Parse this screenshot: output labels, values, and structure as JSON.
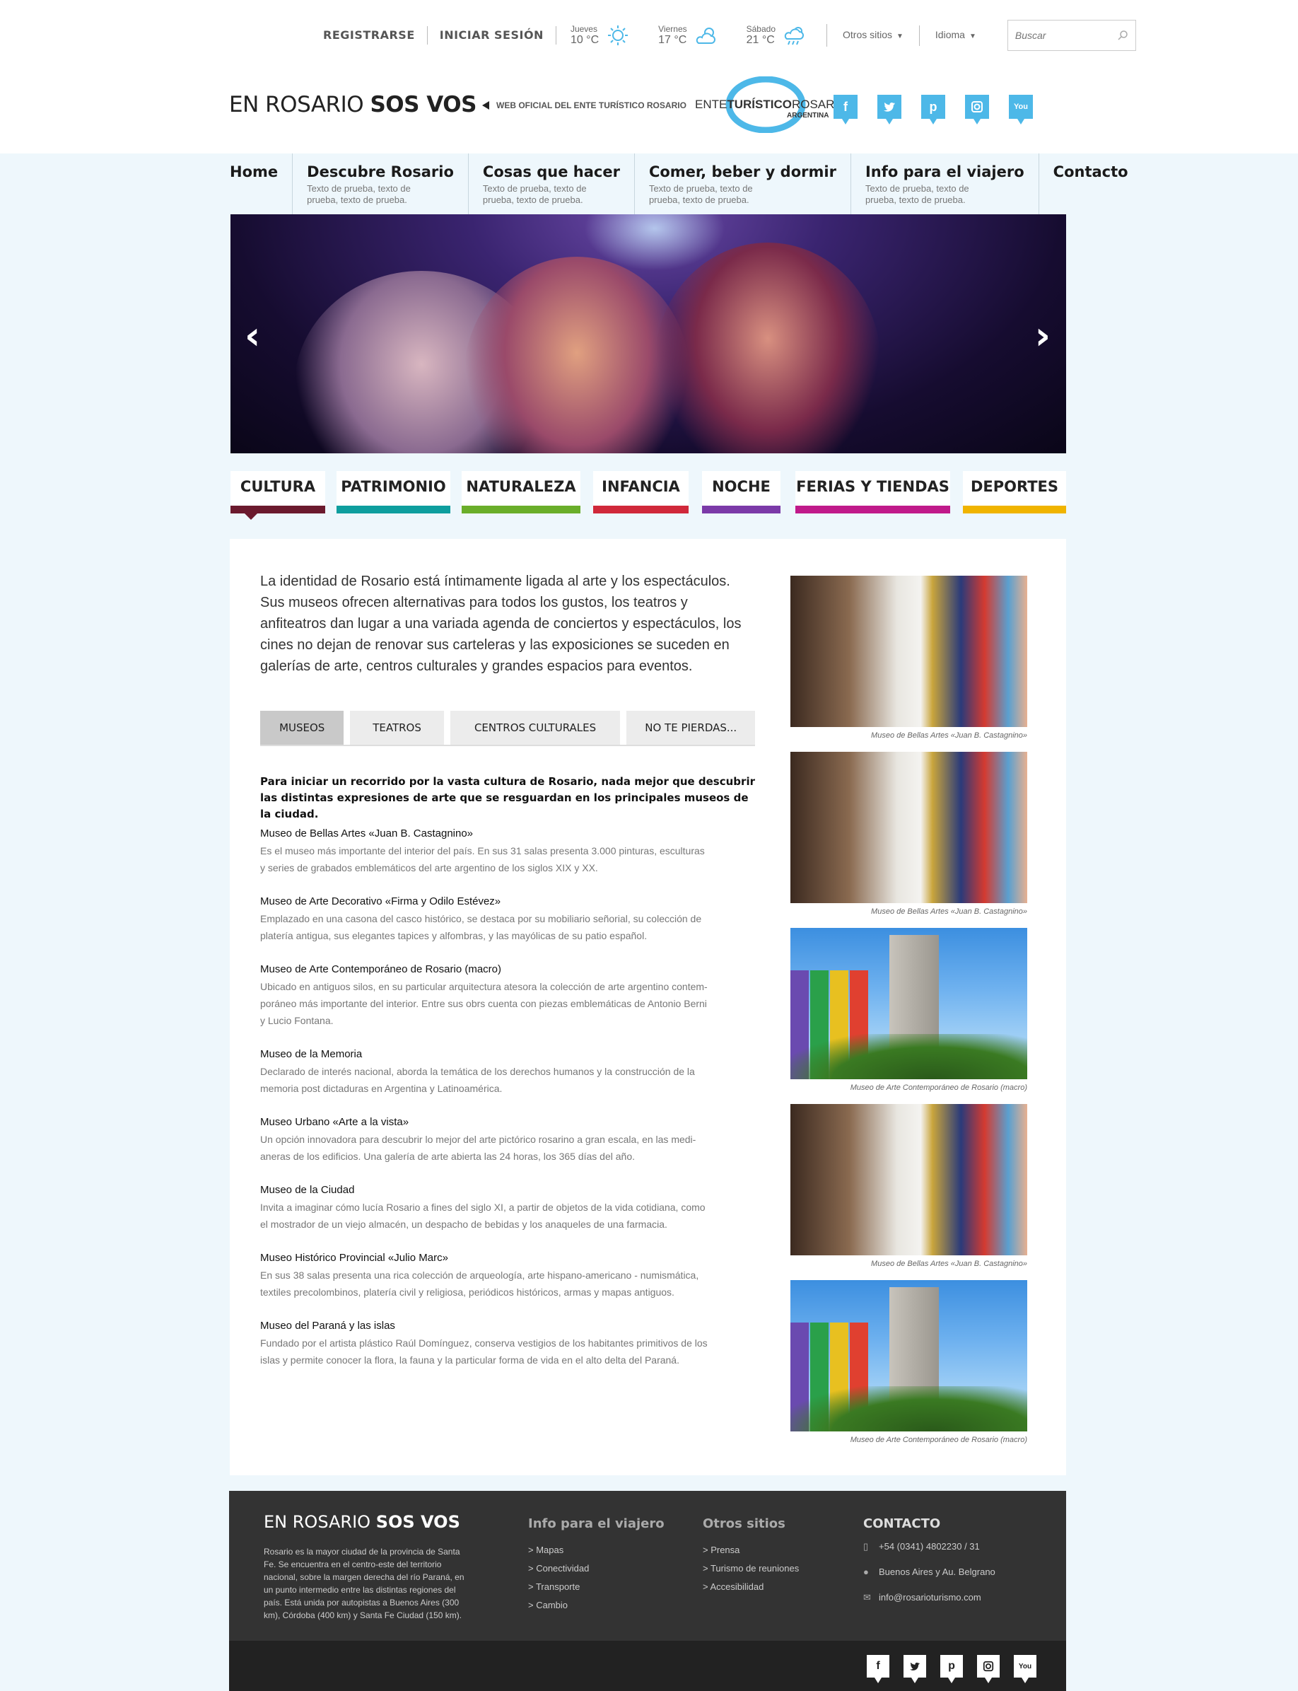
{
  "topbar": {
    "register": "REGISTRARSE",
    "login": "INICIAR SESIÓN",
    "weather": [
      {
        "day": "Jueves",
        "temp": "10 °C",
        "icon": "sun-icon"
      },
      {
        "day": "Viernes",
        "temp": "17 °C",
        "icon": "sun-cloud-icon"
      },
      {
        "day": "Sábado",
        "temp": "21 °C",
        "icon": "rain-cloud-icon"
      }
    ],
    "other_sites": "Otros sitios",
    "language": "Idioma",
    "search_placeholder": "Buscar"
  },
  "header": {
    "logo_a": "EN ROSARIO ",
    "logo_b": "SOS VOS",
    "tagline": "WEB OFICIAL DEL ENTE TURÍSTICO ROSARIO",
    "ente_a": "ENTE",
    "ente_b": "TURÍSTICO",
    "ente_c": "ROSARIO",
    "ente_d": "ARGENTINA",
    "socials": [
      "f",
      "t",
      "p",
      "ig",
      "yt"
    ]
  },
  "nav": [
    {
      "title": "Home",
      "sub": ""
    },
    {
      "title": "Descubre Rosario",
      "sub": "Texto de prueba, texto de prueba, texto de prueba."
    },
    {
      "title": "Cosas que hacer",
      "sub": "Texto de prueba, texto de prueba, texto de prueba."
    },
    {
      "title": "Comer, beber y dormir",
      "sub": "Texto de prueba, texto de prueba, texto de prueba."
    },
    {
      "title": "Info para el viajero",
      "sub": "Texto de prueba, texto de prueba, texto de prueba."
    },
    {
      "title": "Contacto",
      "sub": ""
    }
  ],
  "hero": {
    "prev": "‹",
    "next": "›"
  },
  "categories": [
    {
      "label": "CULTURA",
      "color": "#6b1a2e"
    },
    {
      "label": "PATRIMONIO",
      "color": "#0e9e9e"
    },
    {
      "label": "NATURALEZA",
      "color": "#6aae2a"
    },
    {
      "label": "INFANCIA",
      "color": "#d0283a"
    },
    {
      "label": "NOCHE",
      "color": "#7b3aa8"
    },
    {
      "label": "FERIAS Y TIENDAS",
      "color": "#c01a8a"
    },
    {
      "label": "DEPORTES",
      "color": "#f0b400"
    }
  ],
  "content": {
    "intro": "La identidad de Rosario está íntimamente ligada al arte y los espectáculos. Sus museos ofrecen alternativas para todos los gustos, los teatros y anfiteatros dan lugar a una variada agenda de conciertos y espectáculos, los cines no dejan de renovar sus carteleras y las exposiciones se suceden en galerías de arte, centros culturales y grandes espacios para eventos.",
    "tabs": [
      "MUSEOS",
      "TEATROS",
      "CENTROS CULTURALES",
      "NO TE PIERDAS..."
    ],
    "lead_1": "Para iniciar un recorrido por la vasta cultura de Rosario, nada mejor que descubrir",
    "lead_2": "las distintas expresiones de arte que se resguardan en los principales museos de la ciudad.",
    "museums": [
      {
        "title": "Museo de Bellas Artes «Juan B. Castagnino»",
        "desc": [
          "Es el museo más importante del interior del país. En sus 31 salas presenta 3.000 pinturas, esculturas",
          "y series de grabados emblemáticos del arte argentino de los siglos XIX y XX."
        ]
      },
      {
        "title": "Museo de Arte Decorativo «Firma y Odilo Estévez»",
        "desc": [
          "Emplazado en una casona del casco histórico, se destaca por su mobiliario señorial, su colección de",
          "platería antigua, sus elegantes tapices y alfombras, y las mayólicas de su patio español."
        ]
      },
      {
        "title": "Museo de Arte Contemporáneo de Rosario (macro)",
        "desc": [
          "Ubicado en antiguos silos, en su particular arquitectura atesora la colección de arte argentino contem-",
          "poráneo más importante del interior. Entre sus obrs cuenta con piezas emblemáticas de Antonio Berni",
          "y Lucio Fontana."
        ]
      },
      {
        "title": "Museo de la Memoria",
        "desc": [
          "Declarado de interés nacional, aborda la temática de los derechos humanos y la construcción de la",
          "memoria post dictaduras en Argentina y Latinoamérica."
        ]
      },
      {
        "title": "Museo Urbano «Arte a la vista»",
        "desc": [
          "Un opción innovadora para descubrir lo mejor del arte pictórico rosarino a gran escala, en las medi-",
          "aneras de los edificios. Una galería de arte abierta las 24 horas, los 365 días del año."
        ]
      },
      {
        "title": "Museo de la Ciudad",
        "desc": [
          "Invita a imaginar cómo lucía Rosario a fines del siglo XI, a partir de objetos de la vida cotidiana, como",
          "el mostrador de un viejo almacén, un despacho de bebidas y los anaqueles de una farmacia."
        ]
      },
      {
        "title": "Museo Histórico Provincial «Julio Marc»",
        "desc": [
          "En sus 38 salas presenta una rica colección de arqueología, arte hispano-americano - numismática,",
          "textiles precolombinos, platería civil y religiosa, periódicos históricos, armas y mapas antiguos."
        ]
      },
      {
        "title": "Museo del Paraná y las islas",
        "desc": [
          "Fundado por el artista plástico Raúl Domínguez, conserva vestigios de los habitantes primitivos de los",
          "islas y permite conocer la flora, la fauna y la particular forma de vida en el alto delta del Paraná."
        ]
      }
    ],
    "images": [
      {
        "caption": "Museo de Bellas Artes «Juan B. Castagnino»",
        "kind": "gallery"
      },
      {
        "caption": "Museo de Bellas Artes «Juan B. Castagnino»",
        "kind": "gallery"
      },
      {
        "caption": "Museo de Arte Contemporáneo de Rosario (macro)",
        "kind": "silo"
      },
      {
        "caption": "Museo de Bellas Artes «Juan B. Castagnino»",
        "kind": "gallery"
      },
      {
        "caption": "Museo de Arte Contemporáneo de Rosario (macro)",
        "kind": "silo"
      }
    ]
  },
  "footer": {
    "logo_a": "EN ROSARIO ",
    "logo_b": "SOS VOS",
    "desc": "Rosario es la mayor ciudad de la provincia de Santa Fe. Se encuentra en el centro-este del territorio nacional, sobre la margen derecha del río Paraná, en un punto intermedio entre las distintas regiones del país. Está unida por autopistas a Buenos Aires (300 km), Córdoba (400 km) y Santa Fe Ciudad (150 km).",
    "info_title": "Info para el viajero",
    "info_links": [
      "> Mapas",
      "> Conectividad",
      "> Transporte",
      "> Cambio"
    ],
    "other_title": "Otros sitios",
    "other_links": [
      "> Prensa",
      "> Turismo de reuniones",
      "> Accesibilidad"
    ],
    "contact_title": "CONTACTO",
    "phone": "+54 (0341) 4802230 / 31",
    "address": "Buenos Aires y Au. Belgrano",
    "email": "info@rosarioturismo.com",
    "socials": [
      "f",
      "t",
      "p",
      "ig",
      "yt"
    ]
  }
}
